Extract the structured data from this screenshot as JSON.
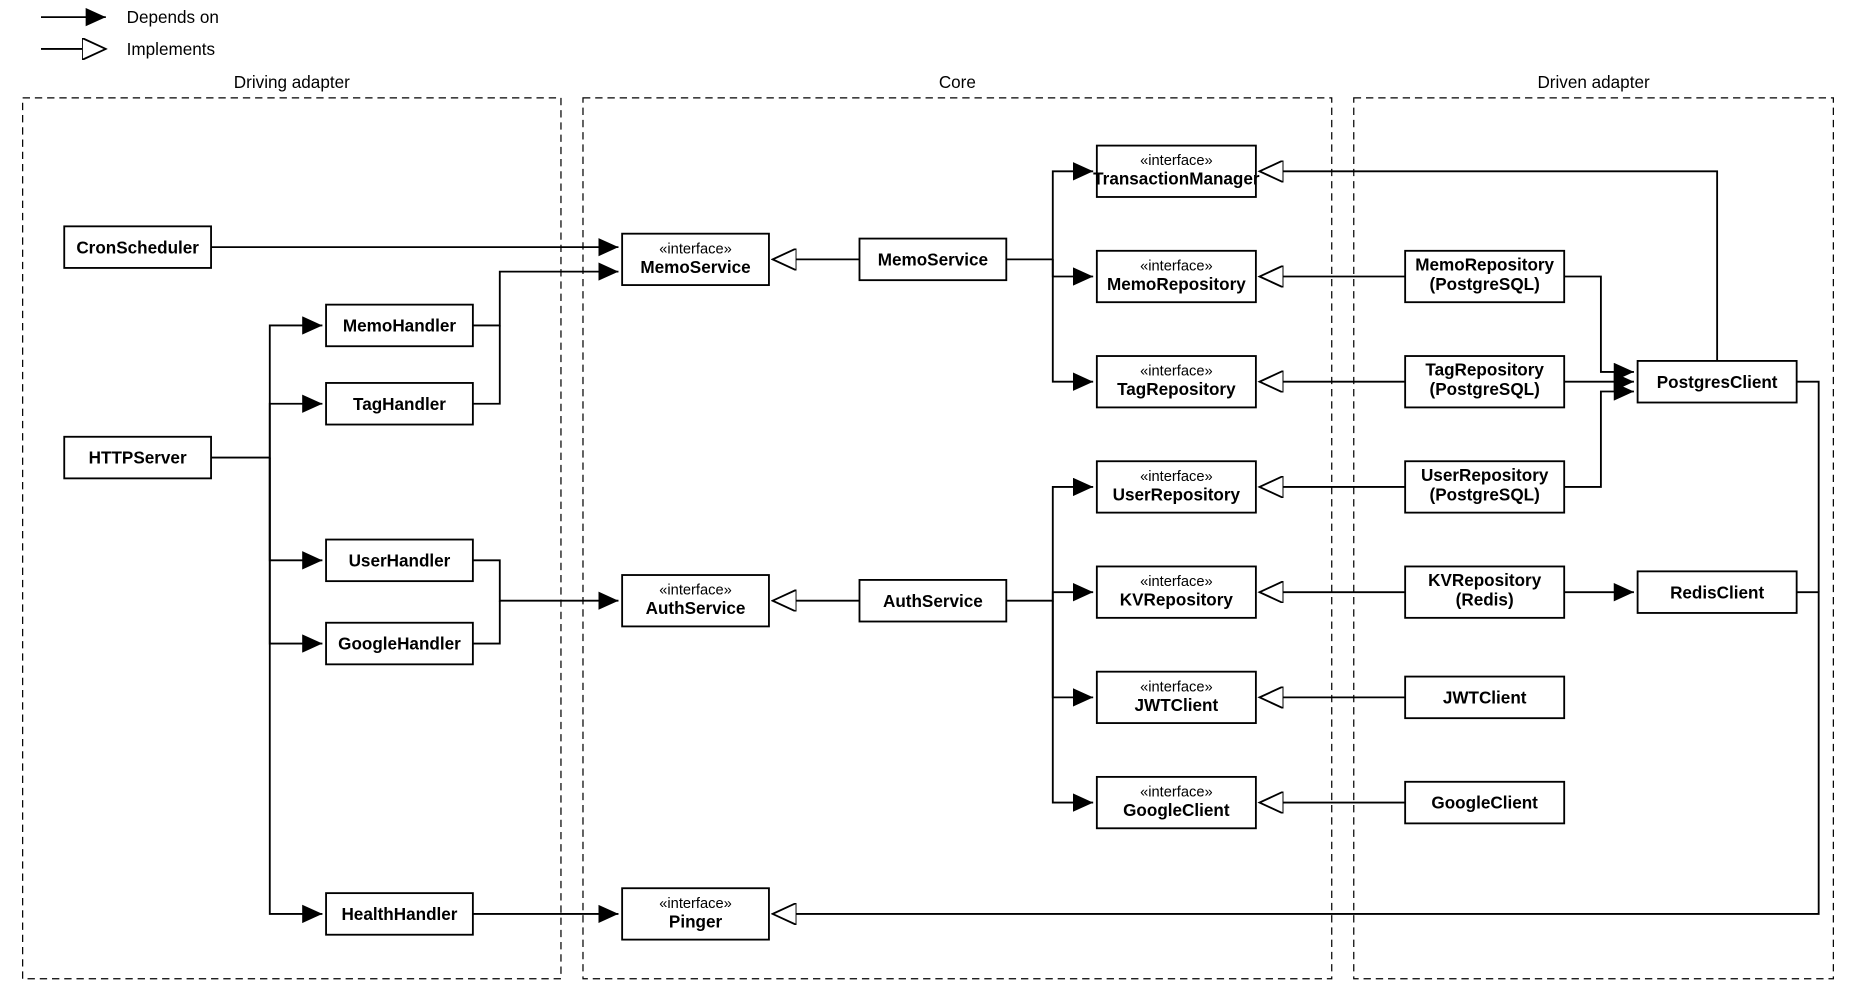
{
  "legend": {
    "depends": "Depends on",
    "implements": "Implements"
  },
  "groups": {
    "driving": "Driving adapter",
    "core": "Core",
    "driven": "Driven adapter"
  },
  "stereotype": "«interface»",
  "boxes": {
    "cron": "CronScheduler",
    "http": "HTTPServer",
    "memoH": "MemoHandler",
    "tagH": "TagHandler",
    "userH": "UserHandler",
    "googleH": "GoogleHandler",
    "healthH": "HealthHandler",
    "iMemoSvc": "MemoService",
    "memoSvc": "MemoService",
    "iAuthSvc": "AuthService",
    "authSvc": "AuthService",
    "iPinger": "Pinger",
    "iTxMgr": "TransactionManager",
    "iMemoRepo": "MemoRepository",
    "iTagRepo": "TagRepository",
    "iUserRepo": "UserRepository",
    "iKVRepo": "KVRepository",
    "iJWT": "JWTClient",
    "iGoogle": "GoogleClient",
    "memoRepo1": "MemoRepository",
    "memoRepo2": "(PostgreSQL)",
    "tagRepo1": "TagRepository",
    "tagRepo2": "(PostgreSQL)",
    "userRepo1": "UserRepository",
    "userRepo2": "(PostgreSQL)",
    "kvRepo1": "KVRepository",
    "kvRepo2": "(Redis)",
    "jwt": "JWTClient",
    "google": "GoogleClient",
    "pg": "PostgresClient",
    "redis": "RedisClient"
  }
}
